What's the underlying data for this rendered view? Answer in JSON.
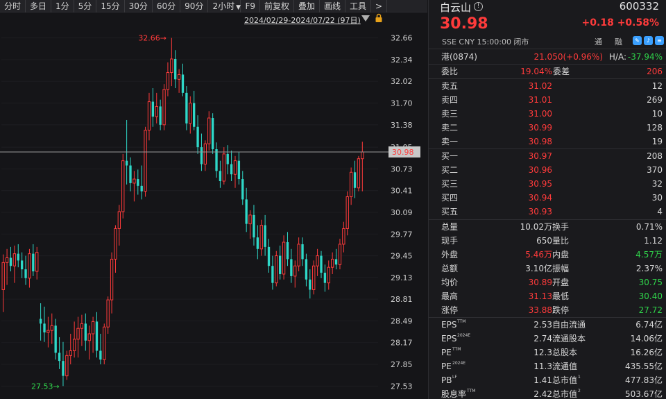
{
  "toolbar": {
    "items": [
      "分时",
      "多日",
      "1分",
      "5分",
      "15分",
      "30分",
      "60分",
      "90分",
      "2小时",
      "F9",
      "前复权",
      "叠加",
      "画线",
      "工具",
      ">"
    ]
  },
  "chart": {
    "date_range": "2024/02/29-2024/07/22 (97日)",
    "current_price_tag": "30.98",
    "max_label": "32.66",
    "min_label": "27.53",
    "up_color": "#ff3b3b",
    "down_color": "#2fd8c8"
  },
  "chart_data": {
    "type": "candlestick",
    "title": "",
    "xlabel": "",
    "ylabel": "",
    "ylim": [
      27.38,
      32.82
    ],
    "yticks": [
      32.66,
      32.34,
      32.02,
      31.7,
      31.38,
      31.05,
      30.73,
      30.41,
      30.09,
      29.77,
      29.45,
      29.13,
      28.81,
      28.49,
      28.17,
      27.85,
      27.53
    ],
    "current_price": 30.98,
    "candles": [
      {
        "o": 28.95,
        "h": 29.47,
        "l": 28.62,
        "c": 29.35
      },
      {
        "o": 29.35,
        "h": 29.55,
        "l": 29.02,
        "c": 29.42
      },
      {
        "o": 29.42,
        "h": 29.58,
        "l": 29.22,
        "c": 29.3
      },
      {
        "o": 29.3,
        "h": 29.6,
        "l": 29.05,
        "c": 29.48
      },
      {
        "o": 29.48,
        "h": 29.62,
        "l": 29.28,
        "c": 29.38
      },
      {
        "o": 29.38,
        "h": 29.5,
        "l": 29.12,
        "c": 29.25
      },
      {
        "o": 29.25,
        "h": 29.45,
        "l": 29.02,
        "c": 29.12
      },
      {
        "o": 29.12,
        "h": 29.55,
        "l": 28.98,
        "c": 29.48
      },
      {
        "o": 29.48,
        "h": 29.62,
        "l": 29.15,
        "c": 29.22
      },
      {
        "o": 29.22,
        "h": 29.58,
        "l": 29.1,
        "c": 29.5
      },
      {
        "o": 28.52,
        "h": 28.75,
        "l": 28.2,
        "c": 28.45
      },
      {
        "o": 28.45,
        "h": 28.7,
        "l": 28.18,
        "c": 28.32
      },
      {
        "o": 28.32,
        "h": 28.55,
        "l": 28.1,
        "c": 28.35
      },
      {
        "o": 28.35,
        "h": 28.6,
        "l": 28.15,
        "c": 28.42
      },
      {
        "o": 28.42,
        "h": 28.52,
        "l": 27.92,
        "c": 28.02
      },
      {
        "o": 28.02,
        "h": 28.25,
        "l": 27.78,
        "c": 27.9
      },
      {
        "o": 27.9,
        "h": 28.18,
        "l": 27.53,
        "c": 27.68
      },
      {
        "o": 27.68,
        "h": 28.05,
        "l": 27.62,
        "c": 27.98
      },
      {
        "o": 27.98,
        "h": 28.3,
        "l": 27.85,
        "c": 28.05
      },
      {
        "o": 28.05,
        "h": 28.48,
        "l": 27.95,
        "c": 28.22
      },
      {
        "o": 28.22,
        "h": 28.55,
        "l": 27.95,
        "c": 28.38
      },
      {
        "o": 28.38,
        "h": 28.58,
        "l": 28.12,
        "c": 28.45
      },
      {
        "o": 28.45,
        "h": 28.6,
        "l": 28.05,
        "c": 28.2
      },
      {
        "o": 28.2,
        "h": 28.42,
        "l": 27.92,
        "c": 28.3
      },
      {
        "o": 28.3,
        "h": 28.55,
        "l": 28.02,
        "c": 28.48
      },
      {
        "o": 28.48,
        "h": 28.62,
        "l": 27.95,
        "c": 28.05
      },
      {
        "o": 28.05,
        "h": 28.3,
        "l": 27.85,
        "c": 27.92
      },
      {
        "o": 27.92,
        "h": 28.45,
        "l": 27.85,
        "c": 28.4
      },
      {
        "o": 28.4,
        "h": 28.85,
        "l": 28.3,
        "c": 28.8
      },
      {
        "o": 28.8,
        "h": 29.5,
        "l": 28.6,
        "c": 29.4
      },
      {
        "o": 29.4,
        "h": 29.9,
        "l": 29.2,
        "c": 29.85
      },
      {
        "o": 29.85,
        "h": 30.2,
        "l": 29.6,
        "c": 30.1
      },
      {
        "o": 30.1,
        "h": 30.95,
        "l": 30.0,
        "c": 30.85
      },
      {
        "o": 30.85,
        "h": 31.45,
        "l": 30.5,
        "c": 30.78
      },
      {
        "o": 30.78,
        "h": 30.9,
        "l": 30.4,
        "c": 30.52
      },
      {
        "o": 30.52,
        "h": 30.7,
        "l": 30.25,
        "c": 30.58
      },
      {
        "o": 30.58,
        "h": 30.72,
        "l": 30.35,
        "c": 30.48
      },
      {
        "o": 30.48,
        "h": 30.78,
        "l": 30.28,
        "c": 30.4
      },
      {
        "o": 30.4,
        "h": 31.35,
        "l": 30.32,
        "c": 31.3
      },
      {
        "o": 31.3,
        "h": 31.85,
        "l": 31.15,
        "c": 31.72
      },
      {
        "o": 31.72,
        "h": 31.92,
        "l": 31.35,
        "c": 31.5
      },
      {
        "o": 31.5,
        "h": 31.85,
        "l": 31.4,
        "c": 31.65
      },
      {
        "o": 31.65,
        "h": 31.75,
        "l": 31.3,
        "c": 31.38
      },
      {
        "o": 31.38,
        "h": 31.98,
        "l": 31.3,
        "c": 31.9
      },
      {
        "o": 31.9,
        "h": 32.3,
        "l": 31.8,
        "c": 32.15
      },
      {
        "o": 32.15,
        "h": 32.66,
        "l": 31.95,
        "c": 32.35
      },
      {
        "o": 32.35,
        "h": 32.48,
        "l": 31.92,
        "c": 32.05
      },
      {
        "o": 32.05,
        "h": 32.2,
        "l": 31.85,
        "c": 32.12
      },
      {
        "o": 32.12,
        "h": 32.28,
        "l": 31.8,
        "c": 31.85
      },
      {
        "o": 31.85,
        "h": 31.95,
        "l": 31.3,
        "c": 31.4
      },
      {
        "o": 31.4,
        "h": 31.8,
        "l": 31.25,
        "c": 31.7
      },
      {
        "o": 31.7,
        "h": 31.88,
        "l": 31.3,
        "c": 31.35
      },
      {
        "o": 31.35,
        "h": 31.52,
        "l": 30.95,
        "c": 31.05
      },
      {
        "o": 31.05,
        "h": 31.25,
        "l": 30.7,
        "c": 30.8
      },
      {
        "o": 30.8,
        "h": 31.15,
        "l": 30.7,
        "c": 31.1
      },
      {
        "o": 31.1,
        "h": 31.58,
        "l": 31.0,
        "c": 31.48
      },
      {
        "o": 31.48,
        "h": 31.55,
        "l": 30.95,
        "c": 31.02
      },
      {
        "o": 31.02,
        "h": 31.12,
        "l": 30.6,
        "c": 30.7
      },
      {
        "o": 30.7,
        "h": 30.85,
        "l": 30.45,
        "c": 30.55
      },
      {
        "o": 30.55,
        "h": 31.05,
        "l": 30.5,
        "c": 30.95
      },
      {
        "o": 30.95,
        "h": 31.08,
        "l": 30.65,
        "c": 30.8
      },
      {
        "o": 30.8,
        "h": 31.0,
        "l": 30.55,
        "c": 30.65
      },
      {
        "o": 30.65,
        "h": 30.92,
        "l": 30.45,
        "c": 30.85
      },
      {
        "o": 30.85,
        "h": 30.98,
        "l": 30.5,
        "c": 30.58
      },
      {
        "o": 30.58,
        "h": 30.7,
        "l": 30.2,
        "c": 30.28
      },
      {
        "o": 30.28,
        "h": 30.45,
        "l": 29.8,
        "c": 29.92
      },
      {
        "o": 29.92,
        "h": 30.12,
        "l": 29.7,
        "c": 30.05
      },
      {
        "o": 30.05,
        "h": 30.2,
        "l": 29.6,
        "c": 29.72
      },
      {
        "o": 29.72,
        "h": 29.9,
        "l": 29.4,
        "c": 29.55
      },
      {
        "o": 29.55,
        "h": 29.98,
        "l": 29.45,
        "c": 29.9
      },
      {
        "o": 29.9,
        "h": 30.05,
        "l": 29.45,
        "c": 29.58
      },
      {
        "o": 29.58,
        "h": 29.7,
        "l": 29.2,
        "c": 29.3
      },
      {
        "o": 29.3,
        "h": 29.45,
        "l": 28.95,
        "c": 29.05
      },
      {
        "o": 29.05,
        "h": 29.52,
        "l": 29.0,
        "c": 29.45
      },
      {
        "o": 29.45,
        "h": 29.6,
        "l": 29.1,
        "c": 29.18
      },
      {
        "o": 29.18,
        "h": 29.75,
        "l": 29.1,
        "c": 29.65
      },
      {
        "o": 29.65,
        "h": 29.8,
        "l": 29.3,
        "c": 29.4
      },
      {
        "o": 29.4,
        "h": 29.55,
        "l": 29.05,
        "c": 29.15
      },
      {
        "o": 29.15,
        "h": 29.38,
        "l": 28.98,
        "c": 29.3
      },
      {
        "o": 29.3,
        "h": 29.72,
        "l": 29.22,
        "c": 29.62
      },
      {
        "o": 29.62,
        "h": 29.72,
        "l": 29.3,
        "c": 29.4
      },
      {
        "o": 29.4,
        "h": 29.48,
        "l": 29.0,
        "c": 29.1
      },
      {
        "o": 29.1,
        "h": 29.25,
        "l": 28.82,
        "c": 28.95
      },
      {
        "o": 28.95,
        "h": 29.38,
        "l": 28.88,
        "c": 29.3
      },
      {
        "o": 29.3,
        "h": 29.55,
        "l": 29.15,
        "c": 29.45
      },
      {
        "o": 29.45,
        "h": 29.52,
        "l": 29.12,
        "c": 29.2
      },
      {
        "o": 29.2,
        "h": 29.32,
        "l": 28.92,
        "c": 29.05
      },
      {
        "o": 29.05,
        "h": 29.38,
        "l": 28.95,
        "c": 29.28
      },
      {
        "o": 29.28,
        "h": 29.5,
        "l": 29.18,
        "c": 29.4
      },
      {
        "o": 29.4,
        "h": 29.55,
        "l": 29.25,
        "c": 29.32
      },
      {
        "o": 29.32,
        "h": 29.7,
        "l": 29.25,
        "c": 29.62
      },
      {
        "o": 29.62,
        "h": 29.95,
        "l": 29.5,
        "c": 29.85
      },
      {
        "o": 29.85,
        "h": 30.4,
        "l": 29.75,
        "c": 30.32
      },
      {
        "o": 30.32,
        "h": 30.75,
        "l": 30.2,
        "c": 30.68
      },
      {
        "o": 30.68,
        "h": 30.85,
        "l": 30.3,
        "c": 30.45
      },
      {
        "o": 30.45,
        "h": 30.92,
        "l": 30.4,
        "c": 30.88
      },
      {
        "o": 30.88,
        "h": 31.13,
        "l": 30.4,
        "c": 30.98
      }
    ]
  },
  "header": {
    "name": "白云山",
    "info_glyph": "!",
    "code": "600332",
    "price": "30.98",
    "change": "+0.18 +0.58%",
    "meta": "SSE  CNY  15:00:00 闭市",
    "tag_tong": "通",
    "tag_rong": "融"
  },
  "hk_row": {
    "label": "港(0874)",
    "value": "21.050(+0.96%)",
    "ah_label": "H/A:",
    "ah_value": "-37.94%"
  },
  "weibi_row": {
    "label": "委比",
    "value": "19.04%",
    "label2": "委差",
    "value2": "206"
  },
  "asks": [
    {
      "label": "卖五",
      "price": "31.02",
      "vol": "12"
    },
    {
      "label": "卖四",
      "price": "31.01",
      "vol": "269"
    },
    {
      "label": "卖三",
      "price": "31.00",
      "vol": "10"
    },
    {
      "label": "卖二",
      "price": "30.99",
      "vol": "128"
    },
    {
      "label": "卖一",
      "price": "30.98",
      "vol": "19"
    }
  ],
  "bids": [
    {
      "label": "买一",
      "price": "30.97",
      "vol": "208"
    },
    {
      "label": "买二",
      "price": "30.96",
      "vol": "370"
    },
    {
      "label": "买三",
      "price": "30.95",
      "vol": "32"
    },
    {
      "label": "买四",
      "price": "30.94",
      "vol": "30"
    },
    {
      "label": "买五",
      "price": "30.93",
      "vol": "4"
    }
  ],
  "stats": [
    {
      "l1": "总量",
      "v1": "10.02万",
      "c1": "white",
      "l2": "换手",
      "v2": "0.71%",
      "c2": "white"
    },
    {
      "l1": "现手",
      "v1": "650",
      "c1": "white",
      "l2": "量比",
      "v2": "1.12",
      "c2": "white"
    },
    {
      "l1": "外盘",
      "v1": "5.46万",
      "c1": "red",
      "l2": "内盘",
      "v2": "4.57万",
      "c2": "green"
    },
    {
      "l1": "总额",
      "v1": "3.10亿",
      "c1": "white",
      "l2": "振幅",
      "v2": "2.37%",
      "c2": "white"
    },
    {
      "l1": "均价",
      "v1": "30.89",
      "c1": "red",
      "l2": "开盘",
      "v2": "30.75",
      "c2": "green"
    },
    {
      "l1": "最高",
      "v1": "31.13",
      "c1": "red",
      "l2": "最低",
      "v2": "30.40",
      "c2": "green"
    },
    {
      "l1": "涨停",
      "v1": "33.88",
      "c1": "red",
      "l2": "跌停",
      "v2": "27.72",
      "c2": "green"
    }
  ],
  "fundamentals": [
    {
      "l1": "EPS",
      "s1": "TTM",
      "v1": "2.53",
      "l2": "自由流通",
      "s2": "",
      "v2": "6.74亿"
    },
    {
      "l1": "EPS",
      "s1": "2024E",
      "v1": "2.74",
      "l2": "流通股本",
      "s2": "",
      "v2": "14.06亿"
    },
    {
      "l1": "PE",
      "s1": "TTM",
      "v1": "12.3",
      "l2": "总股本",
      "s2": "",
      "v2": "16.26亿"
    },
    {
      "l1": "PE",
      "s1": "2024E",
      "v1": "11.3",
      "l2": "流通值",
      "s2": "",
      "v2": "435.55亿"
    },
    {
      "l1": "PB",
      "s1": "LF",
      "v1": "1.41",
      "l2": "总市值",
      "s2": "1",
      "v2": "477.83亿"
    },
    {
      "l1": "股息率",
      "s1": "TTM",
      "v1": "2.42",
      "l2": "总市值",
      "s2": "2",
      "v2": "503.67亿"
    }
  ]
}
